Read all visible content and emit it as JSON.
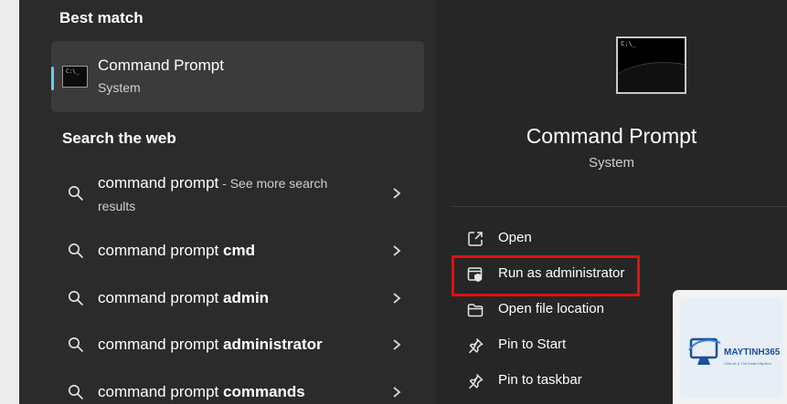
{
  "best_match": {
    "heading": "Best match",
    "title": "Command Prompt",
    "subtitle": "System",
    "icon": "cmd-icon",
    "icon_prompt": "C:\\_"
  },
  "web": {
    "heading": "Search the web",
    "items": [
      {
        "prefix": "command prompt",
        "bold": "",
        "suffix": " - See more search",
        "line2": "results"
      },
      {
        "prefix": "command prompt ",
        "bold": "cmd",
        "suffix": "",
        "line2": ""
      },
      {
        "prefix": "command prompt ",
        "bold": "admin",
        "suffix": "",
        "line2": ""
      },
      {
        "prefix": "command prompt ",
        "bold": "administrator",
        "suffix": "",
        "line2": ""
      },
      {
        "prefix": "command prompt ",
        "bold": "commands",
        "suffix": "",
        "line2": ""
      }
    ]
  },
  "detail": {
    "title": "Command Prompt",
    "subtitle": "System",
    "icon_prompt": "C:\\_"
  },
  "actions": [
    {
      "label": "Open",
      "icon": "open-external-icon"
    },
    {
      "label": "Run as administrator",
      "icon": "shield-window-icon"
    },
    {
      "label": "Open file location",
      "icon": "folder-icon"
    },
    {
      "label": "Pin to Start",
      "icon": "pin-icon"
    },
    {
      "label": "Pin to taskbar",
      "icon": "pin-icon"
    }
  ],
  "watermark": {
    "name": "MAYTINH365",
    "slogan": "Chia sẻ & Thủ thuật Máy tính"
  },
  "colors": {
    "accent": "#60cdff",
    "highlight": "#e01010",
    "panel_left": "#2b2b2b",
    "panel_right": "#262626",
    "card": "#3b3b3b"
  }
}
